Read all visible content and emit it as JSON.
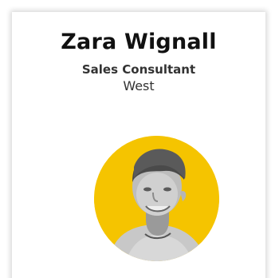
{
  "profile": {
    "name": "Zara Wignall",
    "job_title": "Sales Consultant",
    "region": "West",
    "avatar_background_color": "#f5c400",
    "avatar_style": "grayscale-photo"
  }
}
